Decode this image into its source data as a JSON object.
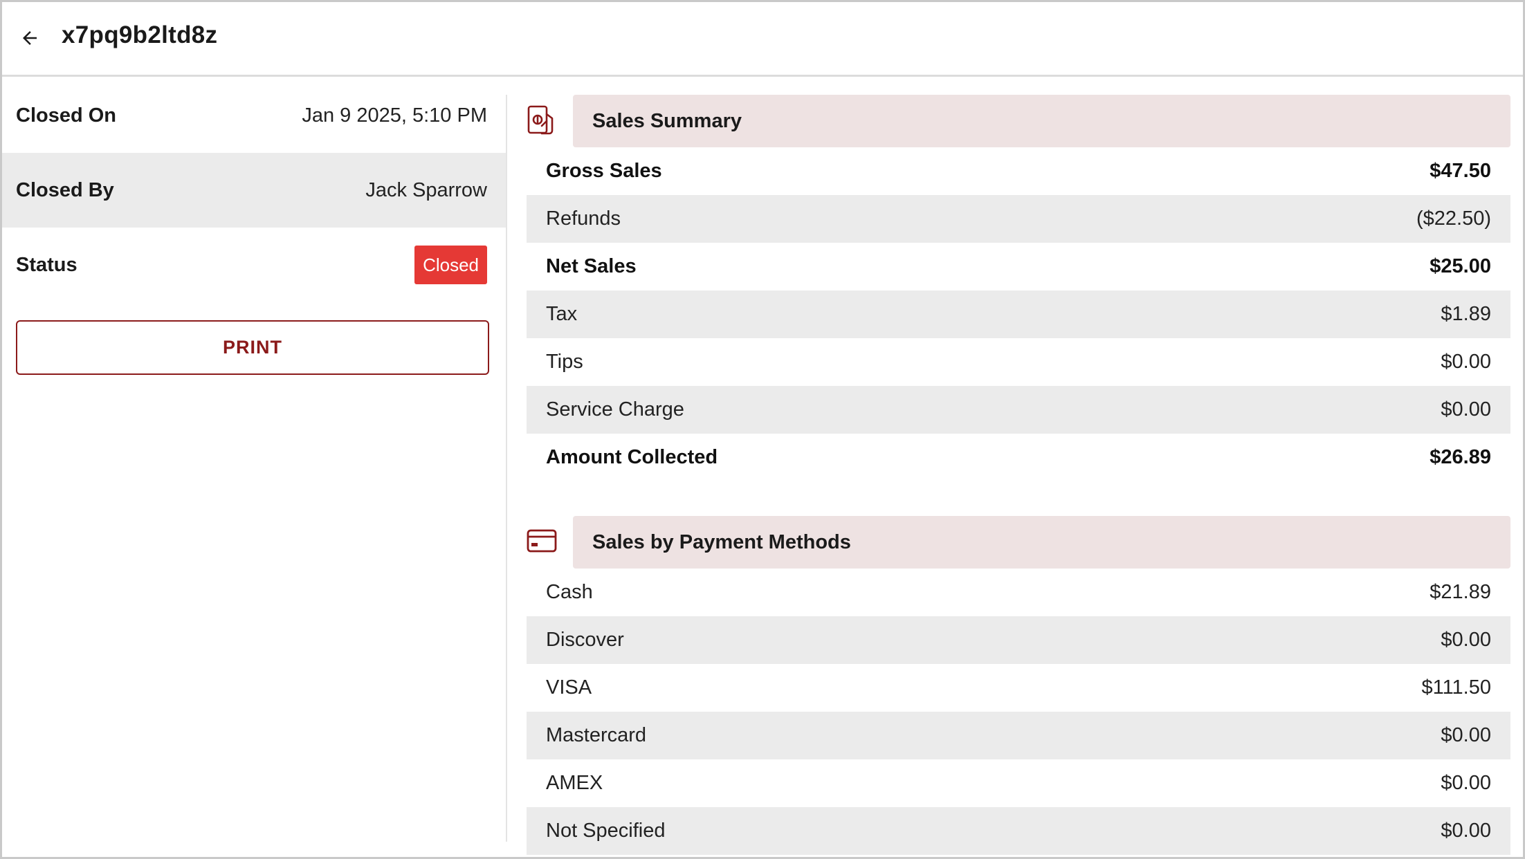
{
  "header": {
    "title": "x7pq9b2ltd8z"
  },
  "details": {
    "closed_on_label": "Closed On",
    "closed_on_value": "Jan 9 2025, 5:10 PM",
    "closed_by_label": "Closed By",
    "closed_by_value": "Jack Sparrow",
    "status_label": "Status",
    "status_value": "Closed",
    "print_label": "PRINT"
  },
  "sales_summary": {
    "title": "Sales Summary",
    "rows": [
      {
        "label": "Gross Sales",
        "value": "$47.50",
        "bold": true
      },
      {
        "label": "Refunds",
        "value": "($22.50)",
        "bold": false
      },
      {
        "label": "Net Sales",
        "value": "$25.00",
        "bold": true
      },
      {
        "label": "Tax",
        "value": "$1.89",
        "bold": false
      },
      {
        "label": "Tips",
        "value": "$0.00",
        "bold": false
      },
      {
        "label": "Service Charge",
        "value": "$0.00",
        "bold": false
      },
      {
        "label": "Amount Collected",
        "value": "$26.89",
        "bold": true
      }
    ]
  },
  "payment_methods": {
    "title": "Sales by Payment Methods",
    "rows": [
      {
        "label": "Cash",
        "value": "$21.89"
      },
      {
        "label": "Discover",
        "value": "$0.00"
      },
      {
        "label": "VISA",
        "value": "$111.50"
      },
      {
        "label": "Mastercard",
        "value": "$0.00"
      },
      {
        "label": "AMEX",
        "value": "$0.00"
      },
      {
        "label": "Not Specified",
        "value": "$0.00"
      }
    ]
  },
  "colors": {
    "accent": "#8b1a1a",
    "status_closed": "#e53935",
    "section_header_bg": "#eee2e2",
    "row_shade": "#ebebeb"
  },
  "icons": {
    "back": "arrow-left-icon",
    "sales_summary": "money-hand-icon",
    "payment_methods": "credit-card-icon"
  }
}
